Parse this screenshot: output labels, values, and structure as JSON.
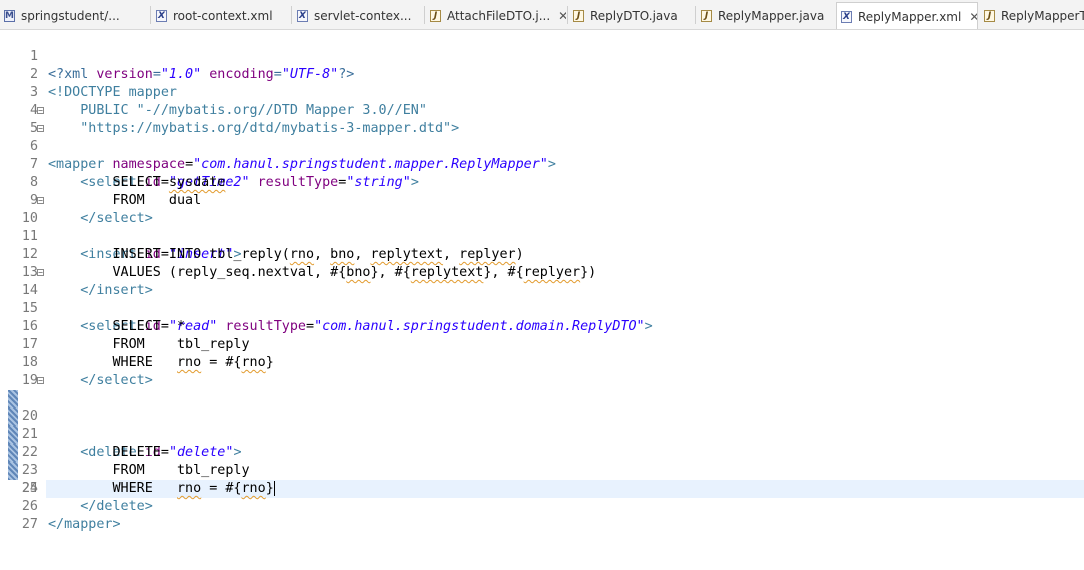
{
  "tabs": [
    {
      "label": "springstudent/...",
      "icon": "maven-pom-icon"
    },
    {
      "label": "root-context.xml",
      "icon": "xml-file-icon"
    },
    {
      "label": "servlet-contex...",
      "icon": "xml-file-icon"
    },
    {
      "label": "AttachFileDTO.j...",
      "icon": "java-file-icon",
      "close": "✕"
    },
    {
      "label": "ReplyDTO.java",
      "icon": "java-file-icon"
    },
    {
      "label": "ReplyMapper.java",
      "icon": "java-file-icon"
    },
    {
      "label": "ReplyMapper.xml",
      "icon": "xml-file-icon",
      "active": true,
      "close": "✕"
    },
    {
      "label": "ReplyMapperTe",
      "icon": "java-file-icon"
    }
  ],
  "editor": {
    "line_numbers": [
      "1",
      "2",
      "3",
      "4",
      "5",
      "6",
      "7",
      "8",
      "9",
      "10",
      "11",
      "12",
      "13",
      "14",
      "15",
      "16",
      "17",
      "18",
      "19",
      "20",
      "21",
      "22",
      "23",
      "24",
      "25",
      "26",
      "27"
    ],
    "current_line": 23,
    "lines": {
      "l1": {
        "a": "<?xml ",
        "b": "version",
        "c": "=",
        "d": "\"1.0\"",
        "e": " encoding",
        "f": "=",
        "g": "\"UTF-8\"",
        "h": "?>"
      },
      "l2": "<!DOCTYPE mapper",
      "l3": "    PUBLIC \"-//mybatis.org//DTD Mapper 3.0//EN\"",
      "l4": "    \"https://mybatis.org/dtd/mybatis-3-mapper.dtd\">",
      "l5": {
        "a": "<mapper ",
        "b": "namespace",
        "c": "=",
        "d": "\"com.hanul.springstudent.mapper.ReplyMapper\"",
        "e": ">"
      },
      "l6": {
        "a": "    <select ",
        "b": "id",
        "c": "=",
        "d": "\"getTime2\"",
        "e": " resultType",
        "f": "=",
        "g": "\"string\"",
        "h": ">"
      },
      "l7": {
        "a": "        SELECT ",
        "b": "sysdate"
      },
      "l8": "        FROM   dual",
      "l9": "    </select>",
      "l10": {
        "a": "    <insert ",
        "b": "id",
        "c": "=",
        "d": "\"insert\"",
        "e": ">"
      },
      "l11": {
        "a": "        INSERT INTO tbl_reply(",
        "b": "rno",
        "c": ", ",
        "d": "bno",
        "e": ", ",
        "f": "replytext",
        "g": ", ",
        "h": "replyer",
        "i": ")"
      },
      "l12": {
        "a": "        VALUES (reply_seq.nextval, #{",
        "b": "bno",
        "c": "}, #{",
        "d": "replytext",
        "e": "}, #{",
        "f": "replyer",
        "g": "})"
      },
      "l13": "    </insert>",
      "l14": {
        "a": "    <select ",
        "b": "id",
        "c": "=",
        "d": "\"read\"",
        "e": " resultType",
        "f": "=",
        "g": "\"com.hanul.springstudent.domain.ReplyDTO\"",
        "h": ">"
      },
      "l15": "        SELECT  *",
      "l16": "        FROM    tbl_reply",
      "l17": {
        "a": "        WHERE   ",
        "b": "rno",
        "c": " = #{",
        "d": "rno",
        "e": "}"
      },
      "l18": "    </select>",
      "l19": "",
      "l20": {
        "a": "    <delete ",
        "b": "id",
        "c": "=",
        "d": "\"delete\"",
        "e": ">"
      },
      "l21": "        DELETE",
      "l22": "        FROM    tbl_reply",
      "l23": {
        "a": "        WHERE   ",
        "b": "rno",
        "c": " = #{",
        "d": "rno",
        "e": "}"
      },
      "l24": "    </delete>",
      "l25": "",
      "l26": "</mapper>",
      "l27": ""
    }
  }
}
